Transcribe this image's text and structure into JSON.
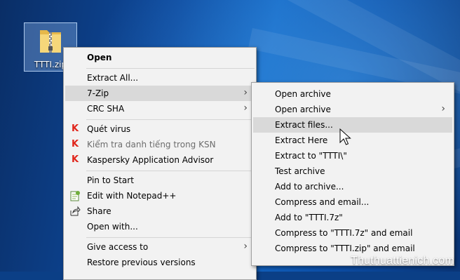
{
  "desktop": {
    "file_label": "TTTI.zip",
    "watermark": "Thuthuattienich.com"
  },
  "context_menu": {
    "open": "Open",
    "extract_all": "Extract All...",
    "seven_zip": "7-Zip",
    "crc_sha": "CRC SHA",
    "scan_virus": "Quét virus",
    "check_ksn": "Kiểm tra danh tiếng trong KSN",
    "kaspersky_advisor": "Kaspersky Application Advisor",
    "pin_to_start": "Pin to Start",
    "edit_notepad": "Edit with Notepad++",
    "share": "Share",
    "open_with": "Open with...",
    "give_access": "Give access to",
    "restore_versions": "Restore previous versions"
  },
  "submenu_7zip": {
    "open_archive": "Open archive",
    "open_archive_more": "Open archive",
    "extract_files": "Extract files...",
    "extract_here": "Extract Here",
    "extract_to": "Extract to \"TTTI\\\"",
    "test_archive": "Test archive",
    "add_to_archive": "Add to archive...",
    "compress_email": "Compress and email...",
    "add_to_7z": "Add to \"TTTI.7z\"",
    "compress_7z_email": "Compress to \"TTTI.7z\" and email",
    "compress_zip_email": "Compress to \"TTTI.zip\" and email"
  }
}
